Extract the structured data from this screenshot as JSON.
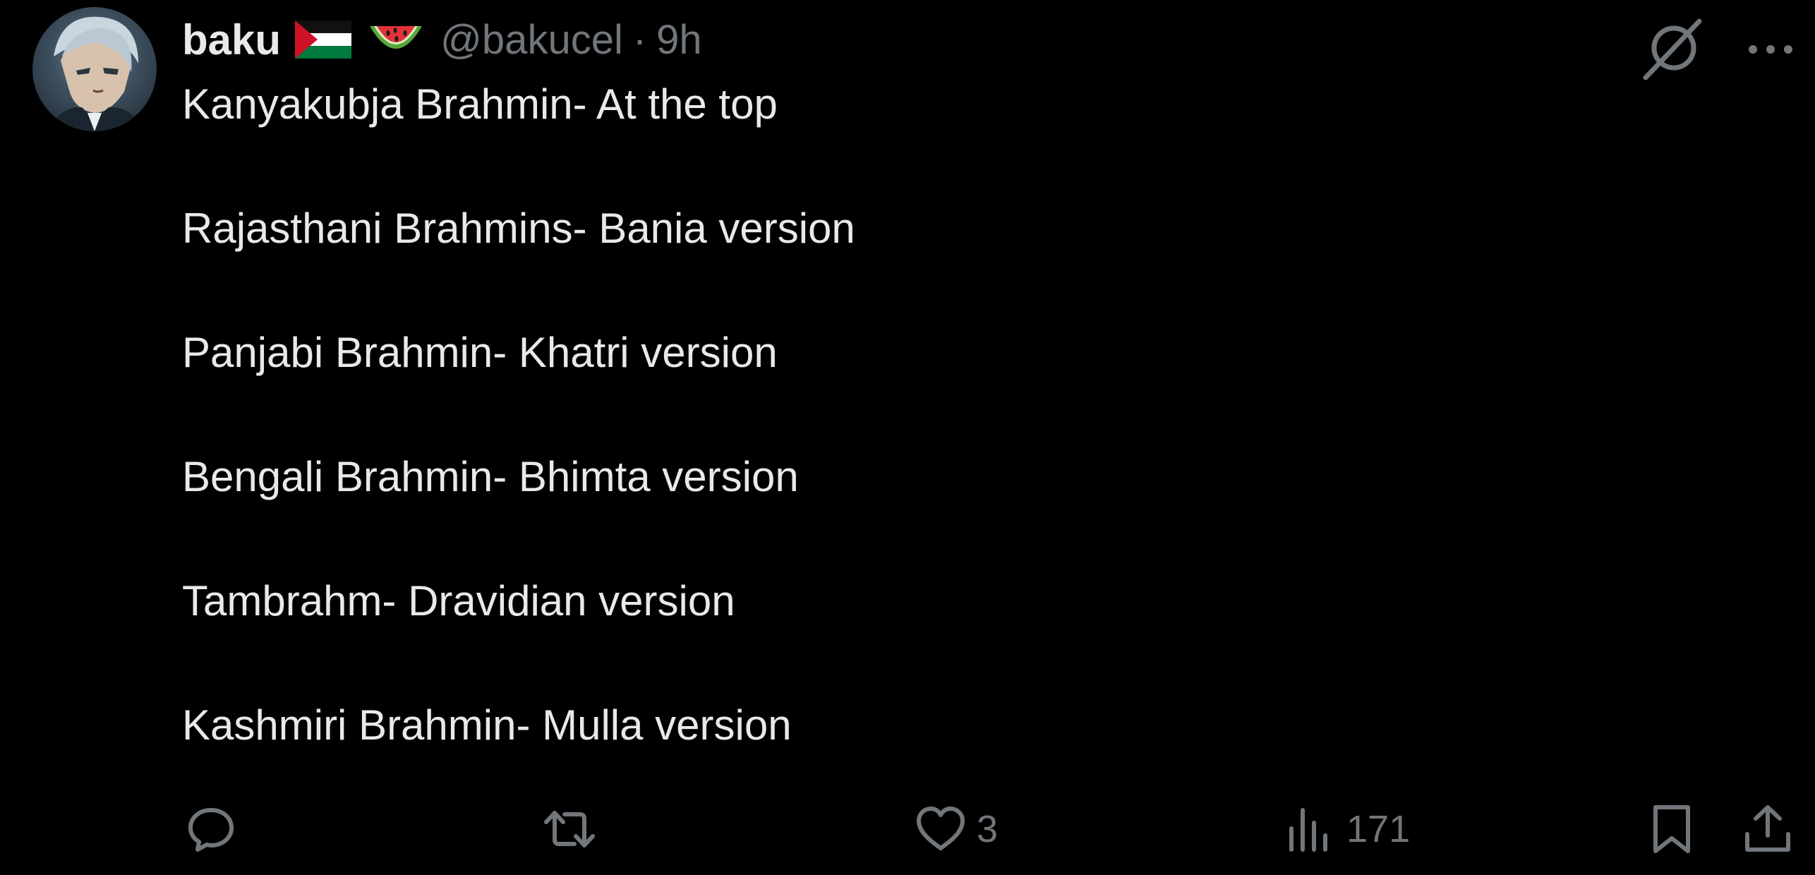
{
  "author": {
    "display_name": "baku",
    "handle": "@bakucel",
    "separator": "·",
    "time": "9h",
    "badges": [
      "palestine-flag-icon",
      "watermelon-icon"
    ]
  },
  "tweet_lines": [
    "Kanyakubja Brahmin- At the top",
    "Rajasthani Brahmins- Bania version",
    "Panjabi Brahmin- Khatri version",
    "Bengali Brahmin- Bhimta version",
    "Tambrahm- Dravidian version",
    "Kashmiri Brahmin- Mulla version"
  ],
  "actions": {
    "reply": {
      "icon": "reply-icon",
      "count": ""
    },
    "retweet": {
      "icon": "retweet-icon",
      "count": ""
    },
    "like": {
      "icon": "heart-icon",
      "count": "3"
    },
    "views": {
      "icon": "views-icon",
      "count": "171"
    },
    "bookmark": {
      "icon": "bookmark-icon"
    },
    "share": {
      "icon": "share-icon"
    }
  },
  "top_actions": [
    "grok-icon",
    "more-icon"
  ],
  "colors": {
    "background": "#000000",
    "text_primary": "#e7e9ea",
    "text_secondary": "#71767b",
    "flag_red": "#ce1126",
    "flag_green": "#007a3d",
    "melon_red": "#e5323a",
    "melon_green": "#5aa53a"
  }
}
